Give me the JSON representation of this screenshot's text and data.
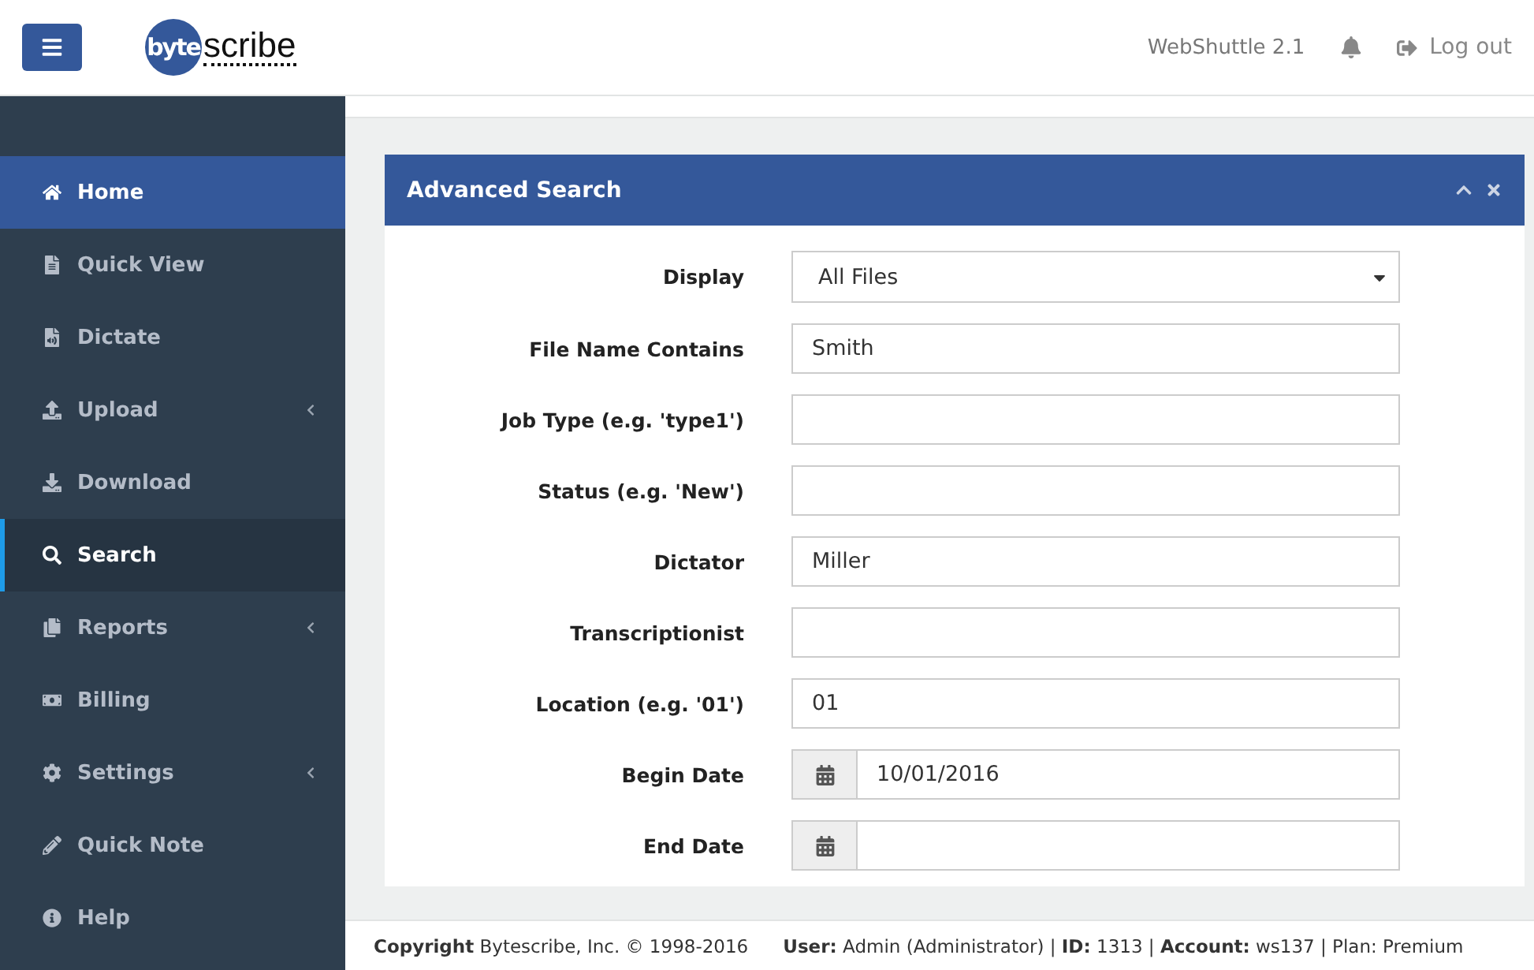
{
  "header": {
    "logo": {
      "left": "byte",
      "right": "scribe"
    },
    "app_version": "WebShuttle 2.1",
    "logout": "Log out"
  },
  "sidebar": {
    "items": [
      {
        "label": "Home",
        "highlighted": true,
        "selected": false,
        "submenu": false
      },
      {
        "label": "Quick View",
        "highlighted": false,
        "selected": false,
        "submenu": false
      },
      {
        "label": "Dictate",
        "highlighted": false,
        "selected": false,
        "submenu": false
      },
      {
        "label": "Upload",
        "highlighted": false,
        "selected": false,
        "submenu": true
      },
      {
        "label": "Download",
        "highlighted": false,
        "selected": false,
        "submenu": false
      },
      {
        "label": "Search",
        "highlighted": false,
        "selected": true,
        "submenu": false
      },
      {
        "label": "Reports",
        "highlighted": false,
        "selected": false,
        "submenu": true
      },
      {
        "label": "Billing",
        "highlighted": false,
        "selected": false,
        "submenu": false
      },
      {
        "label": "Settings",
        "highlighted": false,
        "selected": false,
        "submenu": true
      },
      {
        "label": "Quick Note",
        "highlighted": false,
        "selected": false,
        "submenu": false
      },
      {
        "label": "Help",
        "highlighted": false,
        "selected": false,
        "submenu": false
      }
    ]
  },
  "panel": {
    "title": "Advanced Search",
    "fields": [
      {
        "kind": "select",
        "label": "Display",
        "value": "All Files"
      },
      {
        "kind": "text",
        "label": "File Name Contains",
        "value": "Smith"
      },
      {
        "kind": "text",
        "label": "Job Type (e.g. 'type1')"
      },
      {
        "kind": "text",
        "label": "Status (e.g. 'New')"
      },
      {
        "kind": "text",
        "label": "Dictator",
        "value": "Miller"
      },
      {
        "kind": "text",
        "label": "Transcriptionist"
      },
      {
        "kind": "text",
        "label": "Location (e.g. '01')",
        "value": "01"
      },
      {
        "kind": "date",
        "label": "Begin Date",
        "value": "10/01/2016"
      },
      {
        "kind": "date",
        "label": "End Date"
      }
    ]
  },
  "footer": {
    "copyright": "**Copyright** Bytescribe, Inc. © 1998-2016",
    "user_info": "**User:** Admin (Administrator) | **ID:** 1313 | **Account:** ws137 | Plan: Premium"
  }
}
